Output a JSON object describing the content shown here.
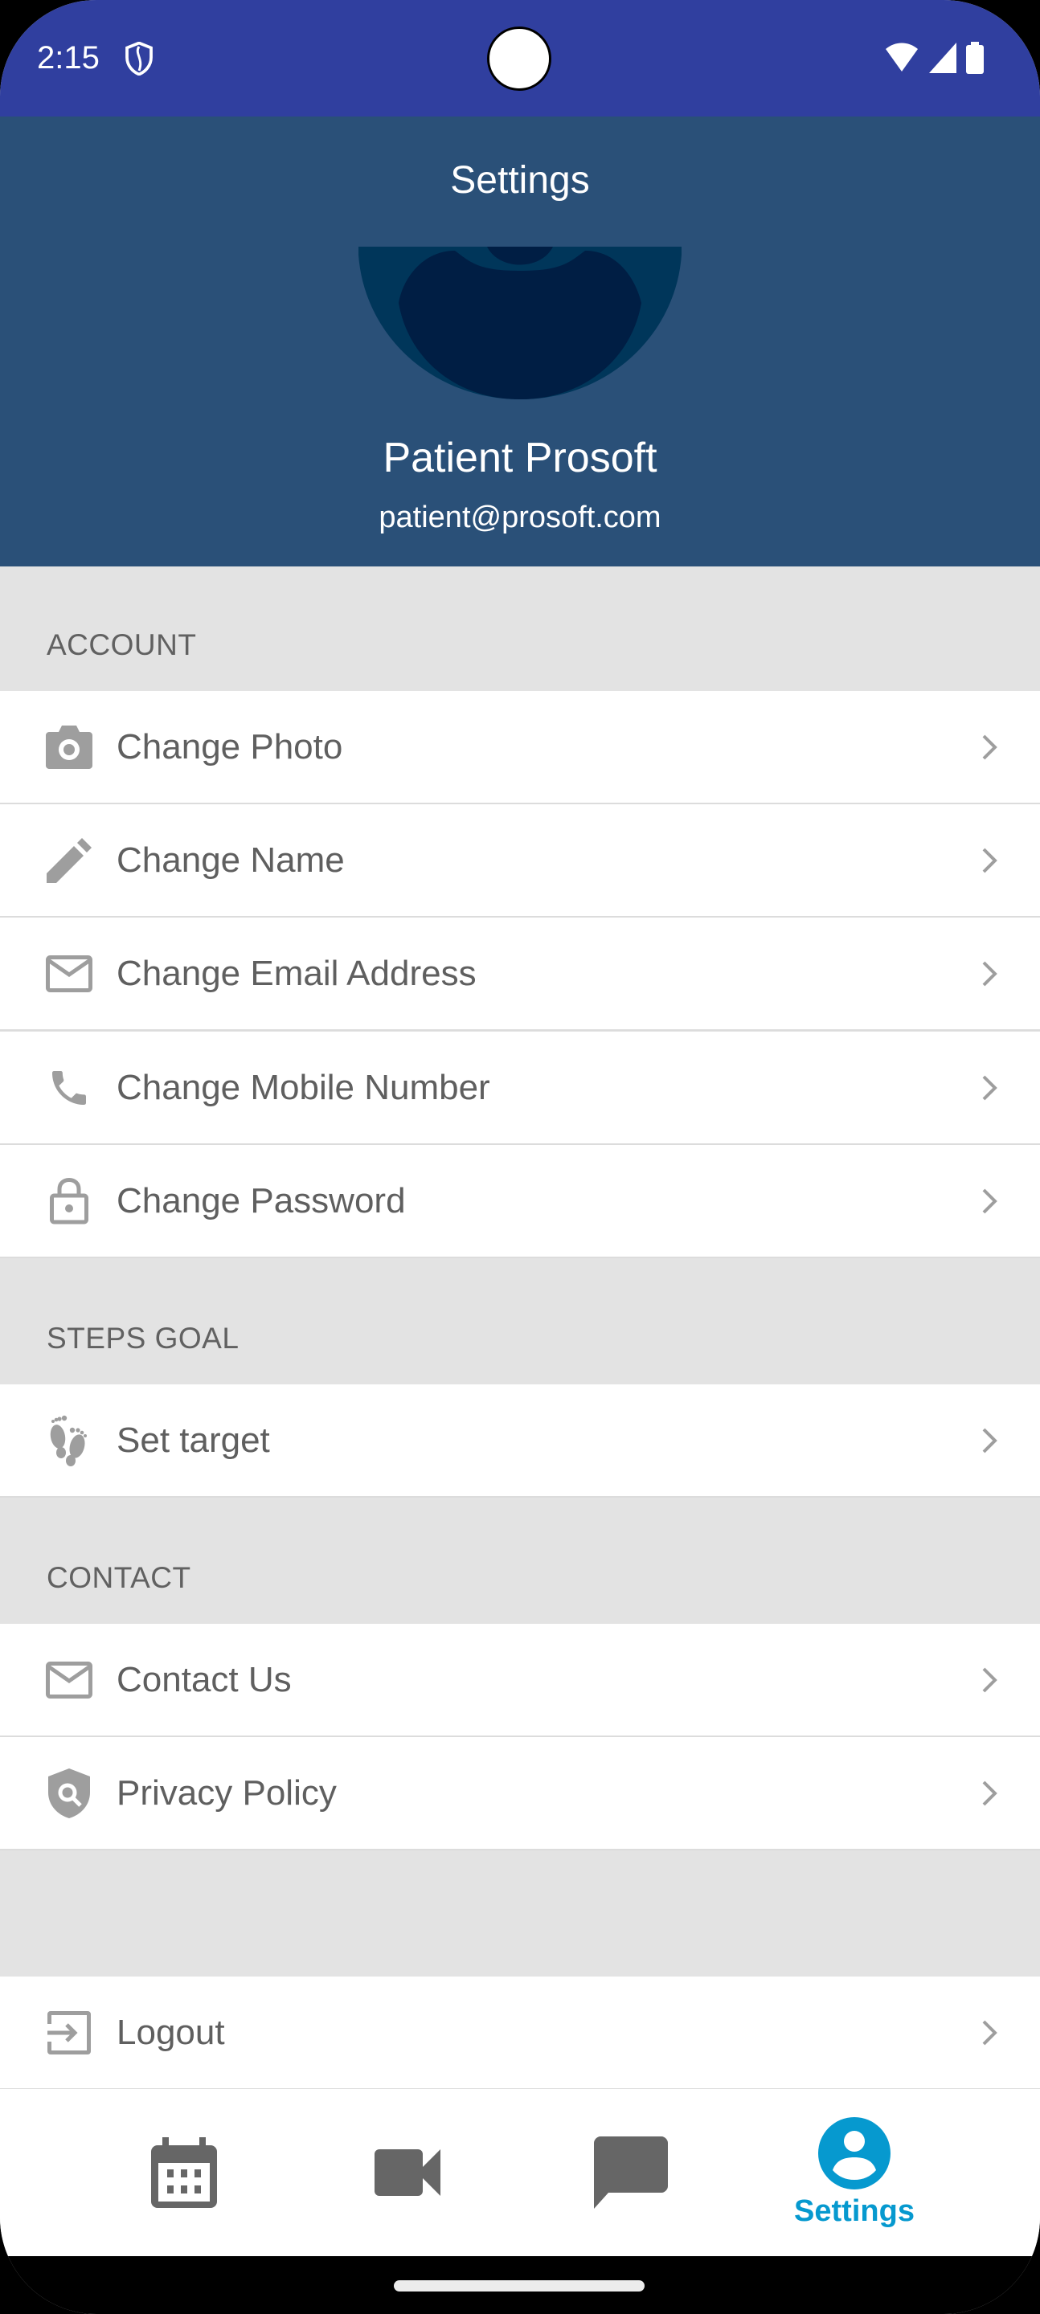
{
  "status_bar": {
    "time": "2:15",
    "icons": [
      "shield-icon",
      "wifi-icon",
      "signal-icon",
      "battery-icon"
    ]
  },
  "header": {
    "title": "Settings",
    "user_name": "Patient Prosoft",
    "user_email": "patient@prosoft.com",
    "bg_color": "#2a5078"
  },
  "sections": {
    "account": {
      "label": "ACCOUNT",
      "items": [
        {
          "label": "Change Photo",
          "icon": "camera-icon"
        },
        {
          "label": "Change Name",
          "icon": "pencil-icon"
        },
        {
          "label": "Change Email Address",
          "icon": "mail-icon"
        },
        {
          "label": "Change Mobile Number",
          "icon": "phone-icon"
        },
        {
          "label": "Change Password",
          "icon": "lock-icon"
        }
      ]
    },
    "steps_goal": {
      "label": "STEPS GOAL",
      "items": [
        {
          "label": "Set target",
          "icon": "footprints-icon"
        }
      ]
    },
    "contact": {
      "label": "CONTACT",
      "items": [
        {
          "label": "Contact Us",
          "icon": "mail-icon"
        },
        {
          "label": "Privacy Policy",
          "icon": "shield-search-icon"
        }
      ]
    },
    "logout": {
      "label": "Logout",
      "icon": "logout-icon"
    }
  },
  "bottom_nav": {
    "items": [
      {
        "name": "calendar",
        "icon": "calendar-icon",
        "label": ""
      },
      {
        "name": "video",
        "icon": "video-icon",
        "label": ""
      },
      {
        "name": "chat",
        "icon": "chat-icon",
        "label": ""
      },
      {
        "name": "settings",
        "icon": "account-circle-icon",
        "label": "Settings",
        "active": true
      }
    ],
    "active_color": "#0699cf"
  }
}
